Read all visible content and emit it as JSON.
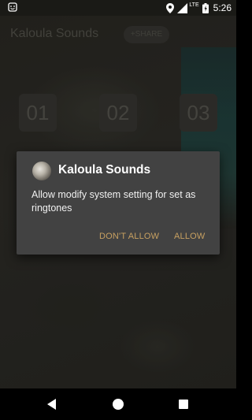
{
  "status_bar": {
    "time": "5:26",
    "network_label": "LTE",
    "icons": [
      "android-notification-icon",
      "location-icon",
      "signal-icon",
      "battery-icon"
    ]
  },
  "app": {
    "title": "Kaloula Sounds",
    "share_label": "+SHARE",
    "tiles": [
      "01",
      "02",
      "03"
    ]
  },
  "dialog": {
    "title": "Kaloula Sounds",
    "message": "Allow modify system setting for set as ringtones",
    "deny_label": "DON'T ALLOW",
    "allow_label": "ALLOW",
    "accent_color": "#c7a061"
  },
  "nav": {
    "icons": [
      "back-icon",
      "home-icon",
      "recents-icon"
    ]
  }
}
